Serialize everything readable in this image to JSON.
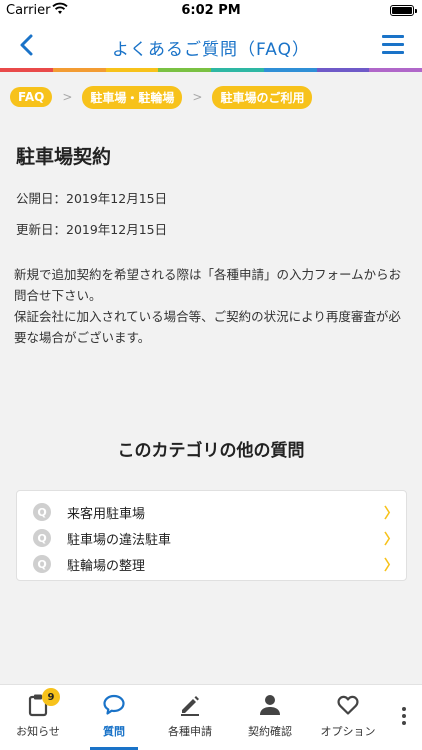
{
  "status_bar": {
    "carrier": "Carrier",
    "time": "6:02 PM"
  },
  "header": {
    "title": "よくあるご質問（FAQ）",
    "back_icon": "chevron-left-icon",
    "menu_icon": "hamburger-menu-icon",
    "rainbow_colors": [
      "#e94a4a",
      "#f39c33",
      "#f7c21b",
      "#7ac143",
      "#2eb7a3",
      "#2f8fd6",
      "#6f5ac8",
      "#b067c9"
    ]
  },
  "breadcrumb": [
    "FAQ",
    "駐車場・駐輪場",
    "駐車場のご利用"
  ],
  "article": {
    "title": "駐車場契約",
    "published": "公開日：2019年12月15日",
    "updated": "更新日：2019年12月15日",
    "body_line1": "新規で追加契約を希望される際は「各種申請」の入力フォームからお問合せ下さい。",
    "body_line2": "保証会社に加入されている場合等、ご契約の状況により再度審査が必要な場合がございます。"
  },
  "other_questions": {
    "heading": "このカテゴリの他の質問",
    "icon_label": "Q",
    "items": [
      "来客用駐車場",
      "駐車場の違法駐車",
      "駐輪場の整理"
    ]
  },
  "tab_bar": {
    "tabs": [
      {
        "label": "お知らせ",
        "icon": "clipboard-icon",
        "badge": "9"
      },
      {
        "label": "質問",
        "icon": "speech-bubble-icon",
        "active": true
      },
      {
        "label": "各種申請",
        "icon": "pencil-icon"
      },
      {
        "label": "契約確認",
        "icon": "person-icon"
      },
      {
        "label": "オプション",
        "icon": "heart-icon"
      }
    ],
    "more_icon": "more-vertical-icon"
  },
  "colors": {
    "accent_blue": "#1a73c8",
    "accent_yellow": "#f7c21b"
  }
}
